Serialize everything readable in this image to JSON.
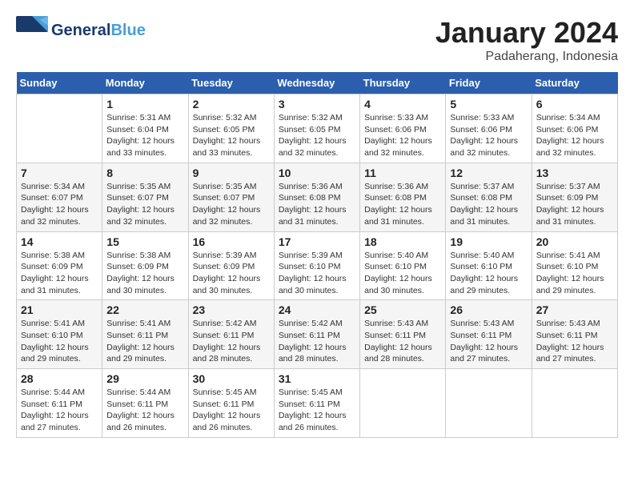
{
  "header": {
    "logo_general": "General",
    "logo_blue": "Blue",
    "month": "January 2024",
    "location": "Padaherang, Indonesia"
  },
  "weekdays": [
    "Sunday",
    "Monday",
    "Tuesday",
    "Wednesday",
    "Thursday",
    "Friday",
    "Saturday"
  ],
  "weeks": [
    [
      {
        "day": "",
        "content": ""
      },
      {
        "day": "1",
        "content": "Sunrise: 5:31 AM\nSunset: 6:04 PM\nDaylight: 12 hours\nand 33 minutes."
      },
      {
        "day": "2",
        "content": "Sunrise: 5:32 AM\nSunset: 6:05 PM\nDaylight: 12 hours\nand 33 minutes."
      },
      {
        "day": "3",
        "content": "Sunrise: 5:32 AM\nSunset: 6:05 PM\nDaylight: 12 hours\nand 32 minutes."
      },
      {
        "day": "4",
        "content": "Sunrise: 5:33 AM\nSunset: 6:06 PM\nDaylight: 12 hours\nand 32 minutes."
      },
      {
        "day": "5",
        "content": "Sunrise: 5:33 AM\nSunset: 6:06 PM\nDaylight: 12 hours\nand 32 minutes."
      },
      {
        "day": "6",
        "content": "Sunrise: 5:34 AM\nSunset: 6:06 PM\nDaylight: 12 hours\nand 32 minutes."
      }
    ],
    [
      {
        "day": "7",
        "content": "Sunrise: 5:34 AM\nSunset: 6:07 PM\nDaylight: 12 hours\nand 32 minutes."
      },
      {
        "day": "8",
        "content": "Sunrise: 5:35 AM\nSunset: 6:07 PM\nDaylight: 12 hours\nand 32 minutes."
      },
      {
        "day": "9",
        "content": "Sunrise: 5:35 AM\nSunset: 6:07 PM\nDaylight: 12 hours\nand 32 minutes."
      },
      {
        "day": "10",
        "content": "Sunrise: 5:36 AM\nSunset: 6:08 PM\nDaylight: 12 hours\nand 31 minutes."
      },
      {
        "day": "11",
        "content": "Sunrise: 5:36 AM\nSunset: 6:08 PM\nDaylight: 12 hours\nand 31 minutes."
      },
      {
        "day": "12",
        "content": "Sunrise: 5:37 AM\nSunset: 6:08 PM\nDaylight: 12 hours\nand 31 minutes."
      },
      {
        "day": "13",
        "content": "Sunrise: 5:37 AM\nSunset: 6:09 PM\nDaylight: 12 hours\nand 31 minutes."
      }
    ],
    [
      {
        "day": "14",
        "content": "Sunrise: 5:38 AM\nSunset: 6:09 PM\nDaylight: 12 hours\nand 31 minutes."
      },
      {
        "day": "15",
        "content": "Sunrise: 5:38 AM\nSunset: 6:09 PM\nDaylight: 12 hours\nand 30 minutes."
      },
      {
        "day": "16",
        "content": "Sunrise: 5:39 AM\nSunset: 6:09 PM\nDaylight: 12 hours\nand 30 minutes."
      },
      {
        "day": "17",
        "content": "Sunrise: 5:39 AM\nSunset: 6:10 PM\nDaylight: 12 hours\nand 30 minutes."
      },
      {
        "day": "18",
        "content": "Sunrise: 5:40 AM\nSunset: 6:10 PM\nDaylight: 12 hours\nand 30 minutes."
      },
      {
        "day": "19",
        "content": "Sunrise: 5:40 AM\nSunset: 6:10 PM\nDaylight: 12 hours\nand 29 minutes."
      },
      {
        "day": "20",
        "content": "Sunrise: 5:41 AM\nSunset: 6:10 PM\nDaylight: 12 hours\nand 29 minutes."
      }
    ],
    [
      {
        "day": "21",
        "content": "Sunrise: 5:41 AM\nSunset: 6:10 PM\nDaylight: 12 hours\nand 29 minutes."
      },
      {
        "day": "22",
        "content": "Sunrise: 5:41 AM\nSunset: 6:11 PM\nDaylight: 12 hours\nand 29 minutes."
      },
      {
        "day": "23",
        "content": "Sunrise: 5:42 AM\nSunset: 6:11 PM\nDaylight: 12 hours\nand 28 minutes."
      },
      {
        "day": "24",
        "content": "Sunrise: 5:42 AM\nSunset: 6:11 PM\nDaylight: 12 hours\nand 28 minutes."
      },
      {
        "day": "25",
        "content": "Sunrise: 5:43 AM\nSunset: 6:11 PM\nDaylight: 12 hours\nand 28 minutes."
      },
      {
        "day": "26",
        "content": "Sunrise: 5:43 AM\nSunset: 6:11 PM\nDaylight: 12 hours\nand 27 minutes."
      },
      {
        "day": "27",
        "content": "Sunrise: 5:43 AM\nSunset: 6:11 PM\nDaylight: 12 hours\nand 27 minutes."
      }
    ],
    [
      {
        "day": "28",
        "content": "Sunrise: 5:44 AM\nSunset: 6:11 PM\nDaylight: 12 hours\nand 27 minutes."
      },
      {
        "day": "29",
        "content": "Sunrise: 5:44 AM\nSunset: 6:11 PM\nDaylight: 12 hours\nand 26 minutes."
      },
      {
        "day": "30",
        "content": "Sunrise: 5:45 AM\nSunset: 6:11 PM\nDaylight: 12 hours\nand 26 minutes."
      },
      {
        "day": "31",
        "content": "Sunrise: 5:45 AM\nSunset: 6:11 PM\nDaylight: 12 hours\nand 26 minutes."
      },
      {
        "day": "",
        "content": ""
      },
      {
        "day": "",
        "content": ""
      },
      {
        "day": "",
        "content": ""
      }
    ]
  ]
}
